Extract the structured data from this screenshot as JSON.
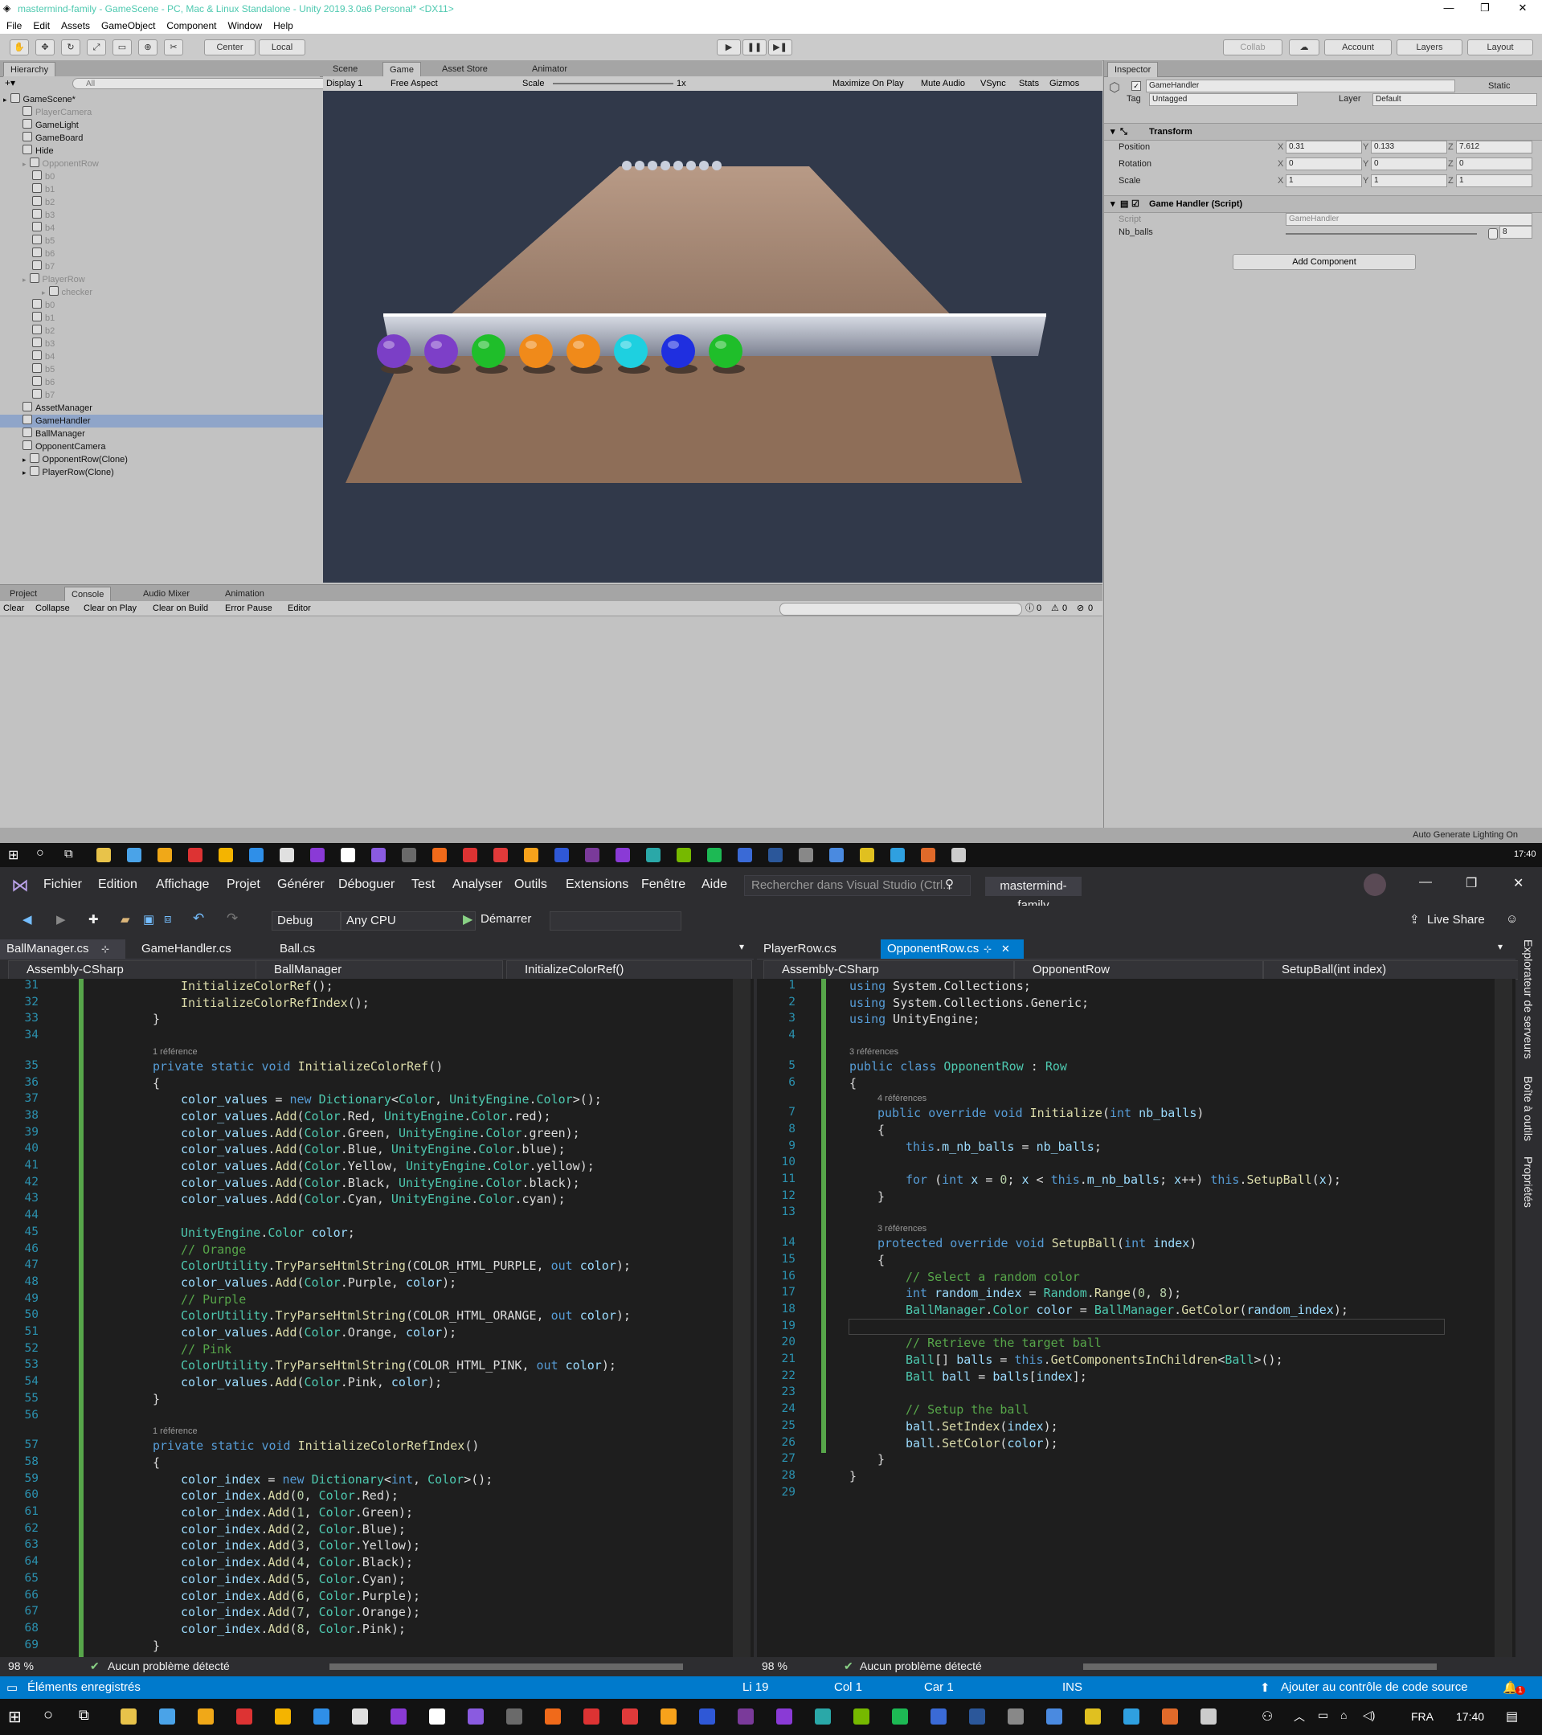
{
  "unity": {
    "title": "mastermind-family - GameScene - PC, Mac & Linux Standalone - Unity 2019.3.0a6 Personal* <DX11>",
    "menu": [
      "File",
      "Edit",
      "Assets",
      "GameObject",
      "Component",
      "Window",
      "Help"
    ],
    "toolbar": {
      "center": "Center",
      "local": "Local",
      "collab": "Collab",
      "account": "Account",
      "layers": "Layers",
      "layout": "Layout"
    },
    "panels": {
      "hierarchy_tab": "Hierarchy",
      "search_placeholder": "All",
      "scene_tab": "Scene",
      "game_tab": "Game",
      "asset_store_tab": "Asset Store",
      "animator_tab": "Animator",
      "inspector_tab": "Inspector",
      "project_tab": "Project",
      "console_tab": "Console",
      "audio_mixer_tab": "Audio Mixer",
      "animation_tab": "Animation"
    },
    "hierarchy": [
      {
        "label": "GameScene*",
        "indent": 0,
        "dim": false,
        "sel": false,
        "arrow": true
      },
      {
        "label": "PlayerCamera",
        "indent": 2,
        "dim": true,
        "sel": false
      },
      {
        "label": "GameLight",
        "indent": 2,
        "dim": false,
        "sel": false
      },
      {
        "label": "GameBoard",
        "indent": 2,
        "dim": false,
        "sel": false
      },
      {
        "label": "Hide",
        "indent": 2,
        "dim": false,
        "sel": false
      },
      {
        "label": "OpponentRow",
        "indent": 2,
        "dim": true,
        "sel": false,
        "arrow": true
      },
      {
        "label": "b0",
        "indent": 3,
        "dim": true,
        "sel": false
      },
      {
        "label": "b1",
        "indent": 3,
        "dim": true,
        "sel": false
      },
      {
        "label": "b2",
        "indent": 3,
        "dim": true,
        "sel": false
      },
      {
        "label": "b3",
        "indent": 3,
        "dim": true,
        "sel": false
      },
      {
        "label": "b4",
        "indent": 3,
        "dim": true,
        "sel": false
      },
      {
        "label": "b5",
        "indent": 3,
        "dim": true,
        "sel": false
      },
      {
        "label": "b6",
        "indent": 3,
        "dim": true,
        "sel": false
      },
      {
        "label": "b7",
        "indent": 3,
        "dim": true,
        "sel": false
      },
      {
        "label": "PlayerRow",
        "indent": 2,
        "dim": true,
        "sel": false,
        "arrow": true
      },
      {
        "label": "checker",
        "indent": 4,
        "dim": true,
        "sel": false,
        "arrow": true
      },
      {
        "label": "b0",
        "indent": 3,
        "dim": true,
        "sel": false
      },
      {
        "label": "b1",
        "indent": 3,
        "dim": true,
        "sel": false
      },
      {
        "label": "b2",
        "indent": 3,
        "dim": true,
        "sel": false
      },
      {
        "label": "b3",
        "indent": 3,
        "dim": true,
        "sel": false
      },
      {
        "label": "b4",
        "indent": 3,
        "dim": true,
        "sel": false
      },
      {
        "label": "b5",
        "indent": 3,
        "dim": true,
        "sel": false
      },
      {
        "label": "b6",
        "indent": 3,
        "dim": true,
        "sel": false
      },
      {
        "label": "b7",
        "indent": 3,
        "dim": true,
        "sel": false
      },
      {
        "label": "AssetManager",
        "indent": 2,
        "dim": false,
        "sel": false
      },
      {
        "label": "GameHandler",
        "indent": 2,
        "dim": false,
        "sel": true
      },
      {
        "label": "BallManager",
        "indent": 2,
        "dim": false,
        "sel": false
      },
      {
        "label": "OpponentCamera",
        "indent": 2,
        "dim": false,
        "sel": false
      },
      {
        "label": "OpponentRow(Clone)",
        "indent": 2,
        "dim": false,
        "sel": false,
        "arrow": true
      },
      {
        "label": "PlayerRow(Clone)",
        "indent": 2,
        "dim": false,
        "sel": false,
        "arrow": true
      }
    ],
    "game_bar": {
      "display": "Display 1",
      "aspect": "Free Aspect",
      "scale_label": "Scale",
      "scale_value": "1x",
      "maximize": "Maximize On Play",
      "mute": "Mute Audio",
      "vsync": "VSync",
      "stats": "Stats",
      "gizmos": "Gizmos"
    },
    "balls": [
      {
        "color": "#7b3fc6"
      },
      {
        "color": "#7d3fc8"
      },
      {
        "color": "#1fbe2a"
      },
      {
        "color": "#f08a1a"
      },
      {
        "color": "#f08a1a"
      },
      {
        "color": "#1ed0e0"
      },
      {
        "color": "#1f2fe0"
      },
      {
        "color": "#1fbe2a"
      }
    ],
    "inspector": {
      "object_name": "GameHandler",
      "static_label": "Static",
      "tag_label": "Tag",
      "tag_value": "Untagged",
      "layer_label": "Layer",
      "layer_value": "Default",
      "transform_title": "Transform",
      "position_label": "Position",
      "rotation_label": "Rotation",
      "scale_label": "Scale",
      "position": [
        "0.31",
        "0.133",
        "7.612"
      ],
      "rotation": [
        "0",
        "0",
        "0"
      ],
      "scale": [
        "1",
        "1",
        "1"
      ],
      "script_title": "Game Handler (Script)",
      "script_label": "Script",
      "script_value": "GameHandler",
      "nb_balls_label": "Nb_balls",
      "nb_balls_value": "8",
      "add_component": "Add Component"
    },
    "console_bar": {
      "clear": "Clear",
      "collapse": "Collapse",
      "clear_on_play": "Clear on Play",
      "clear_on_build": "Clear on Build",
      "error_pause": "Error Pause",
      "editor": "Editor",
      "count_log": "0",
      "count_warn": "0",
      "count_err": "0"
    },
    "status_right": "Auto Generate Lighting On"
  },
  "taskbar_top": {
    "clock": "17:40"
  },
  "vs": {
    "menu": [
      "Fichier",
      "Edition",
      "Affichage",
      "Projet",
      "Générer",
      "Déboguer",
      "Test",
      "Analyser",
      "Outils",
      "Extensions",
      "Fenêtre",
      "Aide"
    ],
    "search_placeholder": "Rechercher dans Visual Studio (Ctrl...",
    "solution": "mastermind-family",
    "live_share": "Live Share",
    "config": "Debug",
    "platform": "Any CPU",
    "start": "Démarrer",
    "left_tabs": [
      "BallManager.cs",
      "GameHandler.cs",
      "Ball.cs"
    ],
    "right_tabs": [
      "PlayerRow.cs",
      "OpponentRow.cs"
    ],
    "left_nav": {
      "project": "Assembly-CSharp",
      "class": "BallManager",
      "member": "InitializeColorRef()"
    },
    "right_nav": {
      "project": "Assembly-CSharp",
      "class": "OpponentRow",
      "member": "SetupBall(int index)"
    },
    "side_rail": [
      "Explorateur de serveurs",
      "Boîte à outils",
      "Propriétés"
    ],
    "zoom": "98 %",
    "no_issues": "Aucun problème détecté",
    "left_lines": [
      {
        "n": "31",
        "h": "<span class='m'>InitializeColorRef</span>();",
        "i": 2
      },
      {
        "n": "32",
        "h": "<span class='m'>InitializeColorRefIndex</span>();",
        "i": 2
      },
      {
        "n": "33",
        "h": "}",
        "i": 1
      },
      {
        "n": "34",
        "h": "",
        "i": 0
      },
      {
        "ref": "1 référence",
        "i": 1
      },
      {
        "n": "35",
        "h": "<span class='k'>private static void</span> <span class='m'>InitializeColorRef</span>()",
        "i": 1
      },
      {
        "n": "36",
        "h": "{",
        "i": 1
      },
      {
        "n": "37",
        "h": "<span class='v'>color_values</span> = <span class='k'>new</span> <span class='t'>Dictionary</span>&lt;<span class='t'>Color</span>, <span class='t'>UnityEngine</span>.<span class='t'>Color</span>&gt;();",
        "i": 2
      },
      {
        "n": "38",
        "h": "<span class='v'>color_values</span>.<span class='m'>Add</span>(<span class='t'>Color</span>.Red, <span class='t'>UnityEngine</span>.<span class='t'>Color</span>.red);",
        "i": 2
      },
      {
        "n": "39",
        "h": "<span class='v'>color_values</span>.<span class='m'>Add</span>(<span class='t'>Color</span>.Green, <span class='t'>UnityEngine</span>.<span class='t'>Color</span>.green);",
        "i": 2
      },
      {
        "n": "40",
        "h": "<span class='v'>color_values</span>.<span class='m'>Add</span>(<span class='t'>Color</span>.Blue, <span class='t'>UnityEngine</span>.<span class='t'>Color</span>.blue);",
        "i": 2
      },
      {
        "n": "41",
        "h": "<span class='v'>color_values</span>.<span class='m'>Add</span>(<span class='t'>Color</span>.Yellow, <span class='t'>UnityEngine</span>.<span class='t'>Color</span>.yellow);",
        "i": 2
      },
      {
        "n": "42",
        "h": "<span class='v'>color_values</span>.<span class='m'>Add</span>(<span class='t'>Color</span>.Black, <span class='t'>UnityEngine</span>.<span class='t'>Color</span>.black);",
        "i": 2
      },
      {
        "n": "43",
        "h": "<span class='v'>color_values</span>.<span class='m'>Add</span>(<span class='t'>Color</span>.Cyan, <span class='t'>UnityEngine</span>.<span class='t'>Color</span>.cyan);",
        "i": 2
      },
      {
        "n": "44",
        "h": "",
        "i": 0
      },
      {
        "n": "45",
        "h": "<span class='t'>UnityEngine</span>.<span class='t'>Color</span> <span class='v'>color</span>;",
        "i": 2
      },
      {
        "n": "46",
        "h": "<span class='c'>// Orange</span>",
        "i": 2
      },
      {
        "n": "47",
        "h": "<span class='t'>ColorUtility</span>.<span class='m'>TryParseHtmlString</span>(COLOR_HTML_PURPLE, <span class='k'>out</span> <span class='v'>color</span>);",
        "i": 2
      },
      {
        "n": "48",
        "h": "<span class='v'>color_values</span>.<span class='m'>Add</span>(<span class='t'>Color</span>.Purple, <span class='v'>color</span>);",
        "i": 2
      },
      {
        "n": "49",
        "h": "<span class='c'>// Purple</span>",
        "i": 2
      },
      {
        "n": "50",
        "h": "<span class='t'>ColorUtility</span>.<span class='m'>TryParseHtmlString</span>(COLOR_HTML_ORANGE, <span class='k'>out</span> <span class='v'>color</span>);",
        "i": 2
      },
      {
        "n": "51",
        "h": "<span class='v'>color_values</span>.<span class='m'>Add</span>(<span class='t'>Color</span>.Orange, <span class='v'>color</span>);",
        "i": 2
      },
      {
        "n": "52",
        "h": "<span class='c'>// Pink</span>",
        "i": 2
      },
      {
        "n": "53",
        "h": "<span class='t'>ColorUtility</span>.<span class='m'>TryParseHtmlString</span>(COLOR_HTML_PINK, <span class='k'>out</span> <span class='v'>color</span>);",
        "i": 2
      },
      {
        "n": "54",
        "h": "<span class='v'>color_values</span>.<span class='m'>Add</span>(<span class='t'>Color</span>.Pink, <span class='v'>color</span>);",
        "i": 2
      },
      {
        "n": "55",
        "h": "}",
        "i": 1
      },
      {
        "n": "56",
        "h": "",
        "i": 0
      },
      {
        "ref": "1 référence",
        "i": 1
      },
      {
        "n": "57",
        "h": "<span class='k'>private static void</span> <span class='m'>InitializeColorRefIndex</span>()",
        "i": 1
      },
      {
        "n": "58",
        "h": "{",
        "i": 1
      },
      {
        "n": "59",
        "h": "<span class='v'>color_index</span> = <span class='k'>new</span> <span class='t'>Dictionary</span>&lt;<span class='k'>int</span>, <span class='t'>Color</span>&gt;();",
        "i": 2
      },
      {
        "n": "60",
        "h": "<span class='v'>color_index</span>.<span class='m'>Add</span>(<span class='n'>0</span>, <span class='t'>Color</span>.Red);",
        "i": 2
      },
      {
        "n": "61",
        "h": "<span class='v'>color_index</span>.<span class='m'>Add</span>(<span class='n'>1</span>, <span class='t'>Color</span>.Green);",
        "i": 2
      },
      {
        "n": "62",
        "h": "<span class='v'>color_index</span>.<span class='m'>Add</span>(<span class='n'>2</span>, <span class='t'>Color</span>.Blue);",
        "i": 2
      },
      {
        "n": "63",
        "h": "<span class='v'>color_index</span>.<span class='m'>Add</span>(<span class='n'>3</span>, <span class='t'>Color</span>.Yellow);",
        "i": 2
      },
      {
        "n": "64",
        "h": "<span class='v'>color_index</span>.<span class='m'>Add</span>(<span class='n'>4</span>, <span class='t'>Color</span>.Black);",
        "i": 2
      },
      {
        "n": "65",
        "h": "<span class='v'>color_index</span>.<span class='m'>Add</span>(<span class='n'>5</span>, <span class='t'>Color</span>.Cyan);",
        "i": 2
      },
      {
        "n": "66",
        "h": "<span class='v'>color_index</span>.<span class='m'>Add</span>(<span class='n'>6</span>, <span class='t'>Color</span>.Purple);",
        "i": 2
      },
      {
        "n": "67",
        "h": "<span class='v'>color_index</span>.<span class='m'>Add</span>(<span class='n'>7</span>, <span class='t'>Color</span>.Orange);",
        "i": 2
      },
      {
        "n": "68",
        "h": "<span class='v'>color_index</span>.<span class='m'>Add</span>(<span class='n'>8</span>, <span class='t'>Color</span>.Pink);",
        "i": 2
      },
      {
        "n": "69",
        "h": "}",
        "i": 1
      }
    ],
    "right_lines": [
      {
        "n": "1",
        "h": "<span class='k'>using</span> System.Collections;",
        "i": 0
      },
      {
        "n": "2",
        "h": "<span class='k'>using</span> System.Collections.Generic;",
        "i": 0
      },
      {
        "n": "3",
        "h": "<span class='k'>using</span> UnityEngine;",
        "i": 0
      },
      {
        "n": "4",
        "h": "",
        "i": 0
      },
      {
        "ref": "3 références",
        "i": 0
      },
      {
        "n": "5",
        "h": "<span class='k'>public class</span> <span class='t'>OpponentRow</span> : <span class='t'>Row</span>",
        "i": 0
      },
      {
        "n": "6",
        "h": "{",
        "i": 0
      },
      {
        "ref": "4 références",
        "i": 1
      },
      {
        "n": "7",
        "h": "<span class='k'>public override void</span> <span class='m'>Initialize</span>(<span class='k'>int</span> <span class='v'>nb_balls</span>)",
        "i": 1
      },
      {
        "n": "8",
        "h": "{",
        "i": 1
      },
      {
        "n": "9",
        "h": "<span class='k'>this</span>.<span class='v'>m_nb_balls</span> = <span class='v'>nb_balls</span>;",
        "i": 2
      },
      {
        "n": "10",
        "h": "",
        "i": 0
      },
      {
        "n": "11",
        "h": "<span class='k'>for</span> (<span class='k'>int</span> <span class='v'>x</span> = <span class='n'>0</span>; <span class='v'>x</span> &lt; <span class='k'>this</span>.<span class='v'>m_nb_balls</span>; <span class='v'>x</span>++) <span class='k'>this</span>.<span class='m'>SetupBall</span>(<span class='v'>x</span>);",
        "i": 2
      },
      {
        "n": "12",
        "h": "}",
        "i": 1
      },
      {
        "n": "13",
        "h": "",
        "i": 0
      },
      {
        "ref": "3 références",
        "i": 1
      },
      {
        "n": "14",
        "h": "<span class='k'>protected override void</span> <span class='m'>SetupBall</span>(<span class='k'>int</span> <span class='v'>index</span>)",
        "i": 1
      },
      {
        "n": "15",
        "h": "{",
        "i": 1
      },
      {
        "n": "16",
        "h": "<span class='c'>// Select a random color</span>",
        "i": 2
      },
      {
        "n": "17",
        "h": "<span class='k'>int</span> <span class='v'>random_index</span> = <span class='t'>Random</span>.<span class='m'>Range</span>(<span class='n'>0</span>, <span class='n'>8</span>);",
        "i": 2
      },
      {
        "n": "18",
        "h": "<span class='t'>BallManager</span>.<span class='t'>Color</span> <span class='v'>color</span> = <span class='t'>BallManager</span>.<span class='m'>GetColor</span>(<span class='v'>random_index</span>);",
        "i": 2
      },
      {
        "n": "19",
        "h": "",
        "i": 0
      },
      {
        "n": "20",
        "h": "<span class='c'>// Retrieve the target ball</span>",
        "i": 2
      },
      {
        "n": "21",
        "h": "<span class='t'>Ball</span>[] <span class='v'>balls</span> = <span class='k'>this</span>.<span class='m'>GetComponentsInChildren</span>&lt;<span class='t'>Ball</span>&gt;();",
        "i": 2
      },
      {
        "n": "22",
        "h": "<span class='t'>Ball</span> <span class='v'>ball</span> = <span class='v'>balls</span>[<span class='v'>index</span>];",
        "i": 2
      },
      {
        "n": "23",
        "h": "",
        "i": 0
      },
      {
        "n": "24",
        "h": "<span class='c'>// Setup the ball</span>",
        "i": 2
      },
      {
        "n": "25",
        "h": "<span class='v'>ball</span>.<span class='m'>SetIndex</span>(<span class='v'>index</span>);",
        "i": 2
      },
      {
        "n": "26",
        "h": "<span class='v'>ball</span>.<span class='m'>SetColor</span>(<span class='v'>color</span>);",
        "i": 2
      },
      {
        "n": "27",
        "h": "}",
        "i": 1
      },
      {
        "n": "28",
        "h": "}",
        "i": 0
      },
      {
        "n": "29",
        "h": "",
        "i": 0
      }
    ],
    "status": {
      "message": "Éléments enregistrés",
      "line": "Li 19",
      "col": "Col 1",
      "char": "Car 1",
      "mode": "INS",
      "source_control": "Ajouter au contrôle de code source",
      "notifications": "1"
    }
  },
  "taskbar_bottom": {
    "lang": "FRA",
    "clock": "17:40"
  }
}
